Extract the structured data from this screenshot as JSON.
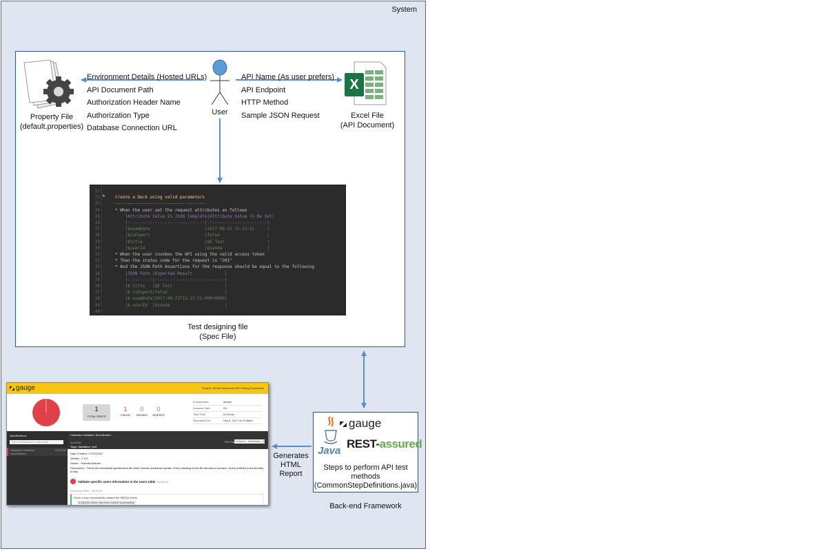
{
  "system": {
    "label": "System"
  },
  "user": {
    "label": "User"
  },
  "property_file": {
    "label_line1": "Property File",
    "label_line2": "(default.properties)"
  },
  "property_details": [
    "Environment Details (Hosted URLs)",
    "API Document Path",
    "Authorization Header Name",
    "Authorization Type",
    "Database Connection URL"
  ],
  "api_details": [
    "API Name (As user prefers)",
    "API Endpoint",
    "HTTP Method",
    "Sample JSON Request"
  ],
  "excel_file": {
    "icon_letter": "X",
    "label_line1": "Excel File",
    "label_line2": "(API Document)"
  },
  "spec_file": {
    "caption_line1": "Test designing file",
    "caption_line2": "(Spec File)",
    "lines": [
      {
        "num": "21",
        "text": "",
        "cls": "c-txt"
      },
      {
        "num": "22",
        "text": "Create a Deck using valid parameters",
        "cls": "c-title"
      },
      {
        "num": "23",
        "text": "------------------------------------",
        "cls": "c-title"
      },
      {
        "num": "24",
        "text": "* When the user set the request attributes as follows",
        "cls": "c-txt"
      },
      {
        "num": "25",
        "text": "    |Attribute Value In JSON Template|Attribute Value To Be Set|",
        "cls": "c-tbl"
      },
      {
        "num": "26",
        "text": "    |-------------------------------|------------------------|",
        "cls": "c-tbl"
      },
      {
        "num": "27",
        "text": "    |$examDate                      |2017-09-21 15:13:51     |",
        "cls": "c-val"
      },
      {
        "num": "28",
        "text": "    |$isExpert                      |false                   |",
        "cls": "c-val"
      },
      {
        "num": "29",
        "text": "    |$title                         |QE Test                 |",
        "cls": "c-val"
      },
      {
        "num": "30",
        "text": "    |$userId                        |Osanda                  |",
        "cls": "c-val"
      },
      {
        "num": "31",
        "text": "* When the user invokes the API using the valid access token",
        "cls": "c-txt"
      },
      {
        "num": "32",
        "text": "* Then the status code for the request is \"201\"",
        "cls": "c-txt"
      },
      {
        "num": "33",
        "text": "* And the JSON Path Assertions for the response should be equal to the following",
        "cls": "c-txt"
      },
      {
        "num": "34",
        "text": "    |JSON Path |Expected Result             |",
        "cls": "c-tbl"
      },
      {
        "num": "35",
        "text": "    |----------|----------------------------|",
        "cls": "c-tbl"
      },
      {
        "num": "36",
        "text": "    |$.title   |QE Test                     |",
        "cls": "c-val"
      },
      {
        "num": "37",
        "text": "    |$.isExpert|false                       |",
        "cls": "c-val"
      },
      {
        "num": "38",
        "text": "    |$.examDate|2017-09-21T15:13:51.000+0000|",
        "cls": "c-val"
      },
      {
        "num": "39",
        "text": "    |$.userId  |Osanda                      |",
        "cls": "c-val"
      },
      {
        "num": "40",
        "text": "",
        "cls": "c-txt"
      }
    ]
  },
  "backend": {
    "gauge_logo": "gauge",
    "java_logo": "Java",
    "rest_logo_part1": "REST-",
    "rest_logo_part2": "assured",
    "desc_line1": "Steps to perform API test",
    "desc_line2": "methods",
    "desc_line3": "(CommonStepDefinitions.java)",
    "caption": "Back-end Framework"
  },
  "report_arrow": {
    "line1": "Generates",
    "line2": "HTML",
    "line3": "Report"
  },
  "report": {
    "logo": "gauge",
    "project": "Project: Smart-Flashcards-API-Testing-Framework",
    "total_specs_value": "1",
    "total_specs_label": "TOTAL SPECS",
    "failed_value": "1",
    "failed_label": "FAILED",
    "passed_value": "0",
    "passed_label": "PASSED",
    "skipped_value": "0",
    "skipped_label": "SKIPPED",
    "env_rows": [
      {
        "k": "Environment",
        "v": "default"
      },
      {
        "k": "Success Rate",
        "v": "0%"
      },
      {
        "k": "Total Time",
        "v": "00:00:06"
      },
      {
        "k": "Generated On",
        "v": "Sep 5, 2017 at 10:48am"
      }
    ],
    "sidebar_title": "Specifications",
    "sidebar_search_placeholder": "Type specification or tag name",
    "sidebar_item": "Database Validation Specification",
    "sidebar_item_time": "00:00:06",
    "spec_title": "Database Validation Specification",
    "file_path_label": "File Path",
    "file_path_value": "C:\\Users\\...\\Database_Validation.spec",
    "spec_time": "00:00:06",
    "tags": "Tags: database_test",
    "body_lines": [
      "Date Created : 07/12/2017",
      "Version : 1.0.0",
      "Owner : Osanda Deshan",
      "Description : This is an executable specification file which follows markdown syntax. Every heading in this file denotes a scenario. Every bulleted point denotes a step."
    ],
    "scenario_title": "Validate specific users information in the users table",
    "scenario_time": "00:00:06",
    "exec_time": "Execution Time : 00:00:01",
    "step1": "Given a user successfully created the MySQL Driver",
    "step2": "# MySQL driver has been loaded successfully"
  }
}
